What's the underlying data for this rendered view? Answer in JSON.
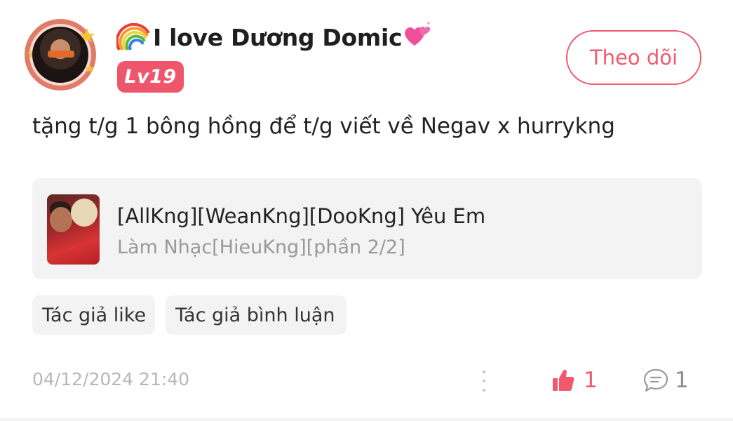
{
  "user": {
    "name": "I love Dương Domic",
    "level": "Lv19"
  },
  "follow_button": {
    "label": "Theo dõi"
  },
  "post": {
    "text": "tặng t/g 1 bông hồng để t/g viết về Negav x hurrykng"
  },
  "linked_story": {
    "title": "[AllKng][WeanKng][DooKng] Yêu Em",
    "subtitle": "Làm Nhạc[HieuKng][phần 2/2]"
  },
  "tags": [
    {
      "label": "Tác giả like"
    },
    {
      "label": "Tác giả bình luận"
    }
  ],
  "footer": {
    "timestamp": "04/12/2024 21:40",
    "like_count": "1",
    "comment_count": "1"
  },
  "colors": {
    "accent": "#f05a6e",
    "badge": "#f0566b",
    "card_bg": "#f3f3f3",
    "muted_text": "#9a9a9a"
  },
  "icons": {
    "rainbow": "rainbow-icon",
    "heart": "sparkling-heart-icon",
    "more": "more-vertical-icon",
    "like": "thumbs-up-icon",
    "comment": "comment-icon"
  }
}
